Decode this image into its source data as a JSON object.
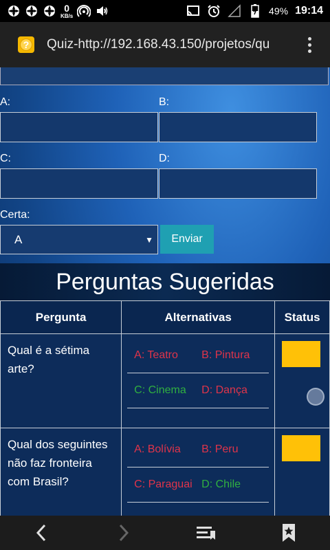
{
  "statusbar": {
    "net_speed_value": "0",
    "net_speed_unit": "KB/s",
    "battery_percent": "49%",
    "time": "19:14"
  },
  "browser": {
    "url_text": "Quiz-http://192.168.43.150/projetos/qu",
    "favicon_glyph": "?"
  },
  "form": {
    "label_a": "A:",
    "label_b": "B:",
    "label_c": "C:",
    "label_d": "D:",
    "label_certa": "Certa:",
    "certa_selected": "A",
    "submit_label": "Enviar"
  },
  "suggested": {
    "title": "Perguntas Sugeridas",
    "headers": {
      "question": "Pergunta",
      "alternatives": "Alternativas",
      "status": "Status"
    },
    "rows": [
      {
        "question": "Qual é a sétima arte?",
        "alts": [
          {
            "text": "A: Teatro",
            "correct": false
          },
          {
            "text": "B: Pintura",
            "correct": false
          },
          {
            "text": "C: Cinema",
            "correct": true
          },
          {
            "text": "D: Dança",
            "correct": false
          }
        ],
        "status_color": "#ffc107"
      },
      {
        "question": "Qual dos seguintes não faz fronteira com Brasil?",
        "alts": [
          {
            "text": "A: Bolívia",
            "correct": false
          },
          {
            "text": "B: Peru",
            "correct": false
          },
          {
            "text": "C: Paraguai",
            "correct": false
          },
          {
            "text": "D: Chile",
            "correct": true
          }
        ],
        "status_color": "#ffc107"
      }
    ]
  },
  "colors": {
    "wrong": "#e0344a",
    "right": "#30b040",
    "button": "#1fa0b2"
  }
}
